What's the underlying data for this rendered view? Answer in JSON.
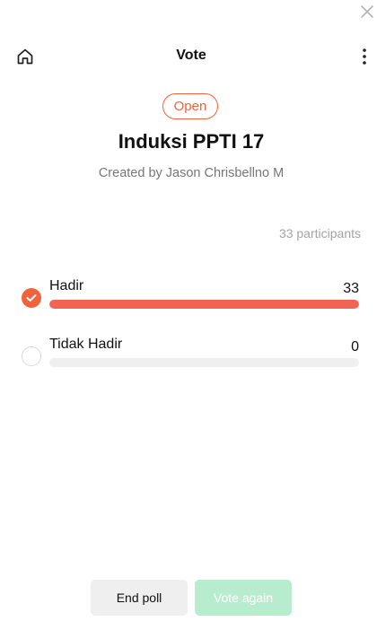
{
  "header": {
    "title": "Vote"
  },
  "poll": {
    "status": "Open",
    "title": "Induksi PPTI 17",
    "creator": "Created by Jason Chrisbellno M",
    "participants": "33 participants",
    "options": [
      {
        "label": "Hadir",
        "count": "33",
        "percent": 100,
        "selected": true
      },
      {
        "label": "Tidak Hadir",
        "count": "0",
        "percent": 0,
        "selected": false
      }
    ]
  },
  "footer": {
    "end_label": "End poll",
    "vote_label": "Vote again"
  },
  "colors": {
    "accent": "#f2623d",
    "bar": "#f26353",
    "vote_again_disabled": "#b8ecce"
  }
}
